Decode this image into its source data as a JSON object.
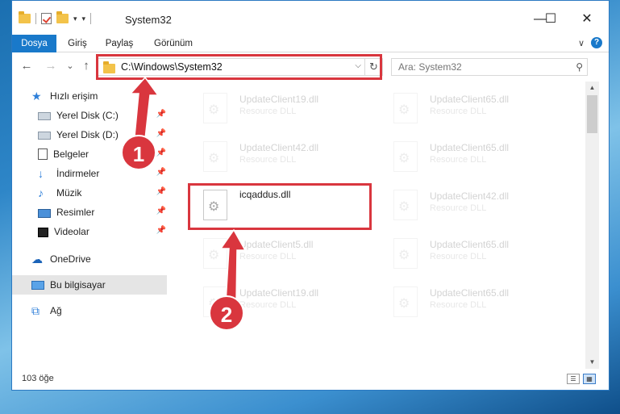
{
  "window": {
    "title": "System32",
    "minimize": "—",
    "maximize": "☐",
    "close": "✕"
  },
  "qat": {
    "chevron": "▾",
    "menu": "▾"
  },
  "ribbon": {
    "tabs": [
      "Dosya",
      "Giriş",
      "Paylaş",
      "Görünüm"
    ],
    "expand": "∨",
    "help": "?"
  },
  "nav": {
    "back": "←",
    "forward": "→",
    "recent": "⌄",
    "up": "↑"
  },
  "address": {
    "path": "C:\\Windows\\System32",
    "dropdown": "⌵",
    "refresh": "↻"
  },
  "search": {
    "placeholder": "Ara: System32",
    "icon": "⚲"
  },
  "sidebar": {
    "pin": "📌",
    "items": [
      {
        "label": "Hızlı erişim",
        "icon": "star-icon",
        "glyph": "★"
      },
      {
        "label": "Yerel Disk (C:)",
        "icon": "drive-icon",
        "glyph": ""
      },
      {
        "label": "Yerel Disk (D:)",
        "icon": "drive-icon",
        "glyph": ""
      },
      {
        "label": "Belgeler",
        "icon": "document-icon",
        "glyph": ""
      },
      {
        "label": "İndirmeler",
        "icon": "download-icon",
        "glyph": "↓"
      },
      {
        "label": "Müzik",
        "icon": "music-icon",
        "glyph": "♪"
      },
      {
        "label": "Resimler",
        "icon": "pictures-icon",
        "glyph": ""
      },
      {
        "label": "Videolar",
        "icon": "video-icon",
        "glyph": ""
      },
      {
        "label": "OneDrive",
        "icon": "cloud-icon",
        "glyph": "☁"
      },
      {
        "label": "Bu bilgisayar",
        "icon": "computer-icon",
        "glyph": ""
      },
      {
        "label": "Ağ",
        "icon": "network-icon",
        "glyph": "⧉"
      }
    ]
  },
  "files": [
    {
      "name": "UpdateClient19.dll",
      "type": "Resource DLL"
    },
    {
      "name": "UpdateClient65.dll",
      "type": "Resource DLL"
    },
    {
      "name": "UpdateClient42.dll",
      "type": "Resource DLL"
    },
    {
      "name": "UpdateClient65.dll",
      "type": "Resource DLL"
    },
    {
      "name": "icqaddus.dll",
      "type": ""
    },
    {
      "name": "UpdateClient42.dll",
      "type": "Resource DLL"
    },
    {
      "name": "UpdateClient5.dll",
      "type": "Resource DLL"
    },
    {
      "name": "UpdateClient65.dll",
      "type": "Resource DLL"
    },
    {
      "name": "UpdateClient19.dll",
      "type": "Resource DLL"
    },
    {
      "name": "UpdateClient65.dll",
      "type": "Resource DLL"
    }
  ],
  "scroll": {
    "up": "▲",
    "down": "▼"
  },
  "status": {
    "count": "103 öğe",
    "details_view": "☰",
    "tiles_view": "▦"
  },
  "annotations": {
    "step1": "1",
    "step2": "2",
    "color": "#d9363e"
  }
}
